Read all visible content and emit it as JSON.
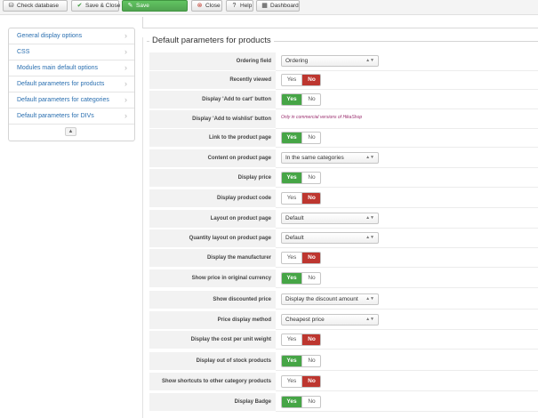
{
  "toolbar": {
    "buttons": [
      {
        "label": "Check database",
        "icon": "database-icon"
      },
      {
        "label": "Save & Close",
        "icon": "check-icon"
      },
      {
        "label": "Save",
        "icon": "edit-icon"
      },
      {
        "label": "Close",
        "icon": "close-icon"
      },
      {
        "label": "Help",
        "icon": "help-icon"
      },
      {
        "label": "Dashboard",
        "icon": "dashboard-icon"
      }
    ]
  },
  "sidebar": {
    "items": [
      {
        "label": "General display options"
      },
      {
        "label": "CSS"
      },
      {
        "label": "Modules main default options"
      },
      {
        "label": "Default parameters for products"
      },
      {
        "label": "Default parameters for categories"
      },
      {
        "label": "Default parameters for DIVs"
      }
    ],
    "collapse_symbol": "▲"
  },
  "main": {
    "legend": "Default parameters for products",
    "yes_label": "Yes",
    "no_label": "No",
    "rows": [
      {
        "label": "Ordering field",
        "type": "select",
        "value": "Ordering"
      },
      {
        "label": "Recently viewed",
        "type": "yesno",
        "value": "no"
      },
      {
        "label": "Display 'Add to cart' button",
        "type": "yesno",
        "value": "yes"
      },
      {
        "label": "Display 'Add to wishlist' button",
        "type": "note",
        "value": "Only in commercial versions of HikaShop"
      },
      {
        "label": "Link to the product page",
        "type": "yesno",
        "value": "yes"
      },
      {
        "label": "Content on product page",
        "type": "select",
        "value": "In the same categories"
      },
      {
        "label": "Display price",
        "type": "yesno",
        "value": "yes"
      },
      {
        "label": "Display product code",
        "type": "yesno",
        "value": "no"
      },
      {
        "label": "Layout on product page",
        "type": "select",
        "value": "Default"
      },
      {
        "label": "Quantity layout on product page",
        "type": "select",
        "value": "Default"
      },
      {
        "label": "Display the manufacturer",
        "type": "yesno",
        "value": "no"
      },
      {
        "label": "Show price in original currency",
        "type": "yesno",
        "value": "yes"
      },
      {
        "label": "Show discounted price",
        "type": "select",
        "value": "Display the discount amount"
      },
      {
        "label": "Price display method",
        "type": "select",
        "value": "Cheapest price"
      },
      {
        "label": "Display the cost per unit weight",
        "type": "yesno",
        "value": "no"
      },
      {
        "label": "Display out of stock products",
        "type": "yesno",
        "value": "yes"
      },
      {
        "label": "Show shortcuts to other category products",
        "type": "yesno",
        "value": "no"
      },
      {
        "label": "Display Badge",
        "type": "yesno",
        "value": "yes"
      }
    ]
  }
}
